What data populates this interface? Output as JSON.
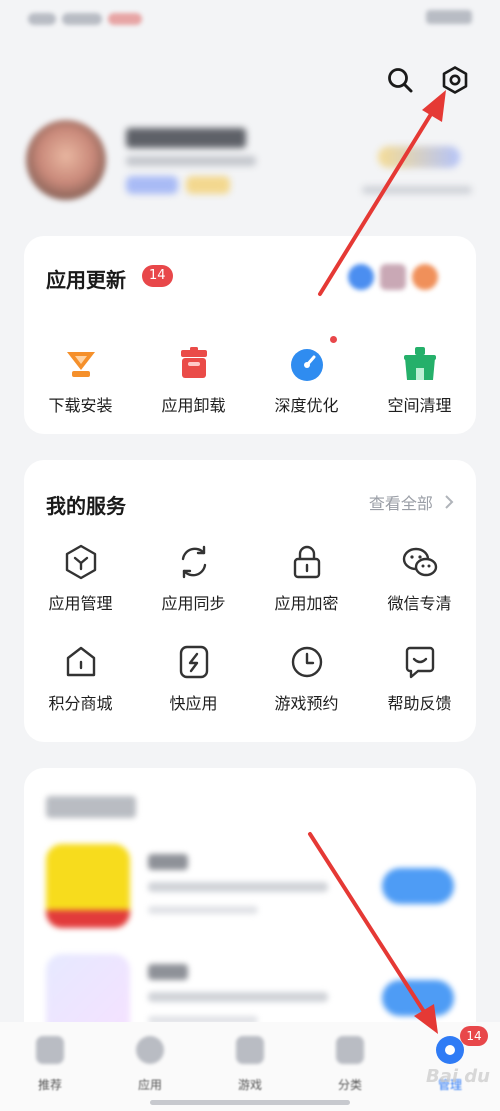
{
  "colors": {
    "accent": "#2f7bf5",
    "badge": "#e8474a",
    "annotation_arrow": "#e53935",
    "update_download": "#f5902b",
    "update_uninstall": "#ea4b48",
    "update_optimize": "#2f8cf0",
    "update_clean": "#25b06a"
  },
  "topbar": {
    "search_icon": "search-icon",
    "settings_icon": "settings-hexagon-icon"
  },
  "updates": {
    "title": "应用更新",
    "count": "14",
    "items": [
      {
        "label": "下载安装",
        "icon": "download-icon"
      },
      {
        "label": "应用卸载",
        "icon": "trash-icon"
      },
      {
        "label": "深度优化",
        "icon": "optimize-gauge-icon"
      },
      {
        "label": "空间清理",
        "icon": "clean-icon"
      }
    ]
  },
  "services": {
    "title": "我的服务",
    "see_all": "查看全部",
    "items": [
      {
        "label": "应用管理",
        "icon": "app-manage-icon"
      },
      {
        "label": "应用同步",
        "icon": "sync-icon"
      },
      {
        "label": "应用加密",
        "icon": "lock-icon"
      },
      {
        "label": "微信专清",
        "icon": "wechat-icon"
      },
      {
        "label": "积分商城",
        "icon": "points-mall-icon"
      },
      {
        "label": "快应用",
        "icon": "quick-app-icon"
      },
      {
        "label": "游戏预约",
        "icon": "clock-icon"
      },
      {
        "label": "帮助反馈",
        "icon": "feedback-icon"
      }
    ]
  },
  "tabbar": {
    "items": [
      {
        "label": "推荐"
      },
      {
        "label": "应用"
      },
      {
        "label": "游戏"
      },
      {
        "label": "分类"
      },
      {
        "label": "管理"
      }
    ],
    "active_index": 4,
    "manage_badge": "14"
  },
  "watermark": "Bai du"
}
